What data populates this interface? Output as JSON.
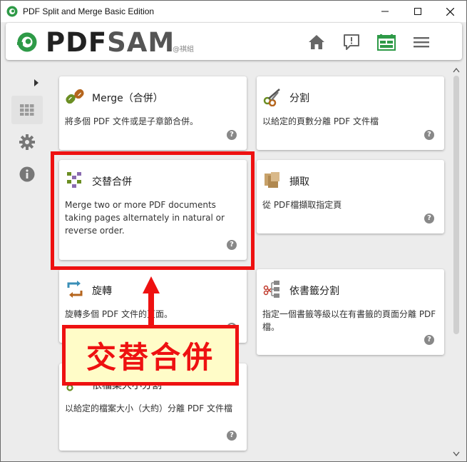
{
  "window": {
    "title": "PDF Split and Merge Basic Edition",
    "controls": [
      "minimize",
      "maximize",
      "close"
    ]
  },
  "header": {
    "logo_pdf": "PDF",
    "logo_sam": "SAM",
    "watermark": "@褀組",
    "icons": [
      "home-icon",
      "feedback-icon",
      "dashboard-icon",
      "menu-icon"
    ],
    "accent_color": "#2e9a47"
  },
  "sidebar": {
    "items": [
      "dashboard-icon",
      "settings-icon",
      "info-icon"
    ]
  },
  "cards": [
    {
      "title": "Merge（合併）",
      "desc": "將多個 PDF 文件或是子章節合併。",
      "icon": "merge-icon"
    },
    {
      "title": "分割",
      "desc": "以給定的頁數分離 PDF 文件檔",
      "icon": "split-icon"
    },
    {
      "title": "交替合併",
      "desc": "Merge two or more PDF documents taking pages alternately in natural or reverse order.",
      "icon": "alternate-mix-icon"
    },
    {
      "title": "擷取",
      "desc": "從 PDF檔擷取指定頁",
      "icon": "extract-icon"
    },
    {
      "title": "旋轉",
      "desc": "旋轉多個 PDF 文件的頁面。",
      "icon": "rotate-icon"
    },
    {
      "title": "依書籤分割",
      "desc": "指定一個書籤等級以在有書籤的頁面分離 PDF 檔。",
      "icon": "split-by-bookmarks-icon"
    },
    {
      "title": "依檔案大小分割",
      "desc": "以給定的檔案大小（大約）分離 PDF 文件檔",
      "icon": "split-by-size-icon"
    }
  ],
  "help_label": "?",
  "annotation": {
    "callout_text": "交替合併",
    "color": "#ee1111",
    "background": "#fffcc8"
  }
}
